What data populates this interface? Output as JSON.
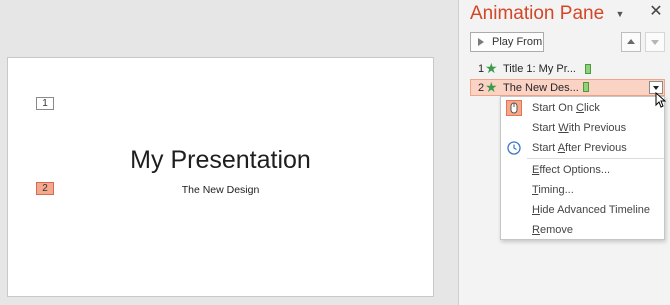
{
  "slide": {
    "tag_1": "1",
    "tag_2": "2",
    "title": "My Presentation",
    "subtitle": "The New Design"
  },
  "pane": {
    "title": "Animation Pane",
    "menu_glyph": "▼",
    "close_glyph": "✕",
    "play_from_label": "Play From",
    "animations": [
      {
        "number": "1",
        "name": "Title 1: My Pr..."
      },
      {
        "number": "2",
        "name": "The New Des..."
      }
    ]
  },
  "context_menu": {
    "items": [
      {
        "pre": "Start On ",
        "key": "C",
        "post": "lick"
      },
      {
        "pre": "Start ",
        "key": "W",
        "post": "ith Previous"
      },
      {
        "pre": "Start ",
        "key": "A",
        "post": "fter Previous"
      },
      {
        "pre": "",
        "key": "E",
        "post": "ffect Options..."
      },
      {
        "pre": "",
        "key": "T",
        "post": "iming..."
      },
      {
        "pre": "",
        "key": "H",
        "post": "ide Advanced Timeline"
      },
      {
        "pre": "",
        "key": "R",
        "post": "emove"
      }
    ]
  },
  "colors": {
    "accent": "#d24726",
    "selection_fill": "#fbd3c4",
    "effect_star": "#3c9b4a",
    "timing_bar": "#8fd17d"
  },
  "icons": [
    "play-icon",
    "up-arrow-icon",
    "down-arrow-icon",
    "entrance-star-icon",
    "mouse-click-icon",
    "clock-icon",
    "close-icon",
    "chevron-down-icon",
    "cursor-icon"
  ]
}
